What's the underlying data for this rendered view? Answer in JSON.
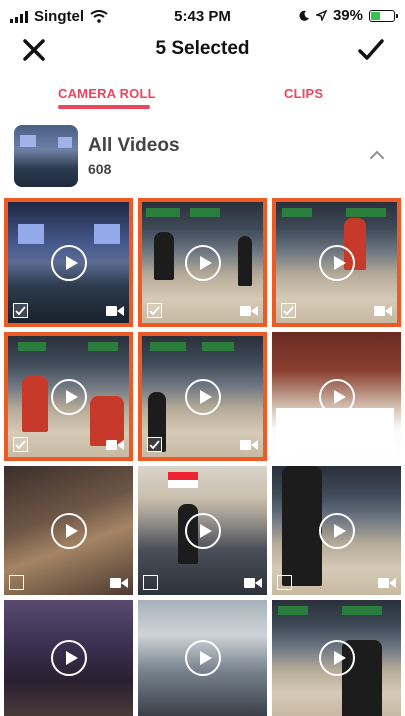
{
  "status": {
    "carrier": "Singtel",
    "time": "5:43 PM",
    "battery": "39%"
  },
  "header": {
    "title": "5 Selected"
  },
  "tabs": [
    {
      "label": "CAMERA ROLL"
    },
    {
      "label": "CLIPS"
    }
  ],
  "album": {
    "title": "All Videos",
    "count": "608"
  },
  "grid": {
    "selected_indices": [
      0,
      1,
      2,
      3,
      4
    ]
  },
  "colors": {
    "accent": "#e8475f",
    "selection": "#ee5a26"
  }
}
